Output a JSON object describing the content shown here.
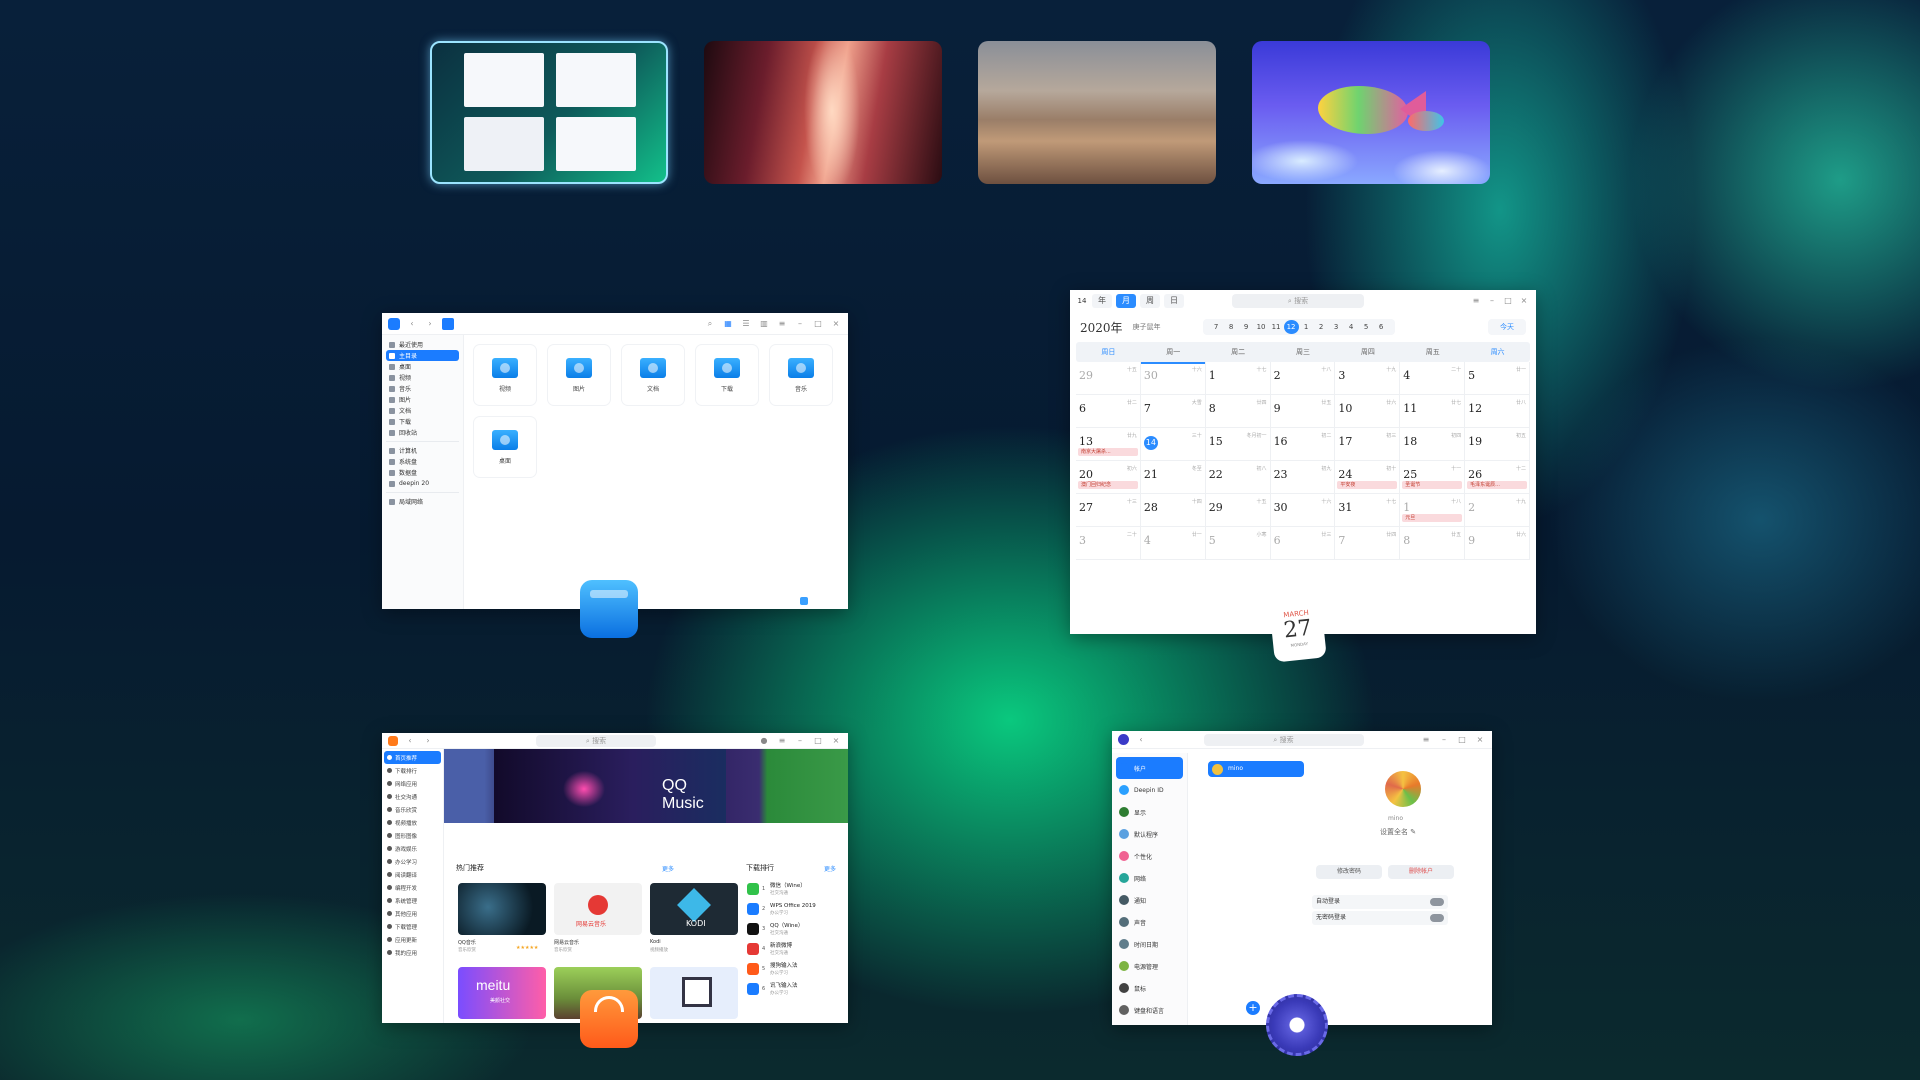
{
  "file_manager": {
    "sidebar": [
      "最近使用",
      "主目录",
      "桌面",
      "视频",
      "音乐",
      "图片",
      "文档",
      "下载",
      "回收站",
      "计算机",
      "系统盘",
      "数据盘",
      "deepin 20",
      "局域网络"
    ],
    "active_index": 1,
    "folders": [
      "视频",
      "图片",
      "文档",
      "下载",
      "音乐",
      "桌面"
    ]
  },
  "calendar": {
    "view_tabs": [
      "年",
      "月",
      "周",
      "日"
    ],
    "active_tab": "月",
    "search_placeholder": "搜索",
    "year": "2020年",
    "lunar_year": "庚子鼠年",
    "months": [
      "7",
      "8",
      "9",
      "10",
      "11",
      "12",
      "1",
      "2",
      "3",
      "4",
      "5",
      "6"
    ],
    "active_month": "12",
    "today_button": "今天",
    "weekdays": [
      "周日",
      "周一",
      "周二",
      "周三",
      "周四",
      "周五",
      "周六"
    ],
    "icon_month": "MARCH",
    "icon_day": "27",
    "icon_weekday": "MONDAY",
    "days": [
      {
        "d": "29",
        "l": "十五",
        "dim": true
      },
      {
        "d": "30",
        "l": "十六",
        "dim": true
      },
      {
        "d": "1",
        "l": "十七"
      },
      {
        "d": "2",
        "l": "十八"
      },
      {
        "d": "3",
        "l": "十九"
      },
      {
        "d": "4",
        "l": "二十"
      },
      {
        "d": "5",
        "l": "廿一"
      },
      {
        "d": "6",
        "l": "廿二"
      },
      {
        "d": "7",
        "l": "大雪"
      },
      {
        "d": "8",
        "l": "廿四"
      },
      {
        "d": "9",
        "l": "廿五"
      },
      {
        "d": "10",
        "l": "廿六"
      },
      {
        "d": "11",
        "l": "廿七"
      },
      {
        "d": "12",
        "l": "廿八"
      },
      {
        "d": "13",
        "l": "廿九",
        "ev": "南京大屠杀..."
      },
      {
        "d": "14",
        "l": "三十",
        "today": true
      },
      {
        "d": "15",
        "l": "冬月初一"
      },
      {
        "d": "16",
        "l": "初二"
      },
      {
        "d": "17",
        "l": "初三"
      },
      {
        "d": "18",
        "l": "初四"
      },
      {
        "d": "19",
        "l": "初五"
      },
      {
        "d": "20",
        "l": "初六",
        "ev": "澳门回归纪念"
      },
      {
        "d": "21",
        "l": "冬至"
      },
      {
        "d": "22",
        "l": "初八"
      },
      {
        "d": "23",
        "l": "初九"
      },
      {
        "d": "24",
        "l": "初十",
        "ev": "平安夜"
      },
      {
        "d": "25",
        "l": "十一",
        "ev": "圣诞节"
      },
      {
        "d": "26",
        "l": "十二",
        "ev": "毛泽东诞辰..."
      },
      {
        "d": "27",
        "l": "十三"
      },
      {
        "d": "28",
        "l": "十四"
      },
      {
        "d": "29",
        "l": "十五"
      },
      {
        "d": "30",
        "l": "十六"
      },
      {
        "d": "31",
        "l": "十七"
      },
      {
        "d": "1",
        "l": "十八",
        "dim": true,
        "ev": "元旦"
      },
      {
        "d": "2",
        "l": "十九",
        "dim": true
      },
      {
        "d": "3",
        "l": "二十",
        "dim": true
      },
      {
        "d": "4",
        "l": "廿一",
        "dim": true
      },
      {
        "d": "5",
        "l": "小寒",
        "dim": true
      },
      {
        "d": "6",
        "l": "廿三",
        "dim": true
      },
      {
        "d": "7",
        "l": "廿四",
        "dim": true
      },
      {
        "d": "8",
        "l": "廿五",
        "dim": true
      },
      {
        "d": "9",
        "l": "廿六",
        "dim": true
      }
    ]
  },
  "app_store": {
    "search_placeholder": "搜索",
    "sidebar": [
      "首页推荐",
      "下载排行",
      "网络应用",
      "社交沟通",
      "音乐欣赏",
      "视频播放",
      "图形图像",
      "游戏娱乐",
      "办公学习",
      "阅读翻译",
      "编程开发",
      "系统管理",
      "其他应用",
      "下载管理",
      "应用更新",
      "我的应用"
    ],
    "banner_title": "QQ Music",
    "hot_title": "热门推荐",
    "rank_title": "下载排行",
    "more": "更多",
    "cards": [
      {
        "name": "QQ音乐",
        "sub": "音乐欣赏"
      },
      {
        "name": "网易云音乐",
        "sub": "音乐欣赏"
      },
      {
        "name": "Kodi",
        "sub": "视频播放"
      }
    ],
    "card_logos": {
      "music": "网易云音乐",
      "kodi": "KODI",
      "meitu": "meitu",
      "meitu_sub": "美颜社交"
    },
    "ranks": [
      {
        "n": "1",
        "t": "微信（Wine）",
        "s": "社交沟通"
      },
      {
        "n": "2",
        "t": "WPS Office 2019",
        "s": "办公学习"
      },
      {
        "n": "3",
        "t": "QQ（Wine）",
        "s": "社交沟通"
      },
      {
        "n": "4",
        "t": "新浪微博",
        "s": "社交沟通"
      },
      {
        "n": "5",
        "t": "搜狗输入法",
        "s": "办公学习"
      },
      {
        "n": "6",
        "t": "讯飞输入法",
        "s": "办公学习"
      }
    ]
  },
  "control_center": {
    "search_placeholder": "搜索",
    "sidebar": [
      "帐户",
      "Deepin ID",
      "显示",
      "默认程序",
      "个性化",
      "网络",
      "通知",
      "声音",
      "时间日期",
      "电源管理",
      "鼠标",
      "键盘和语言"
    ],
    "user": "mino",
    "nickname": "设置全名",
    "btn_password": "修改密码",
    "btn_delete": "删除帐户",
    "row_autologin": "自动登录",
    "row_nopass": "无密码登录"
  }
}
